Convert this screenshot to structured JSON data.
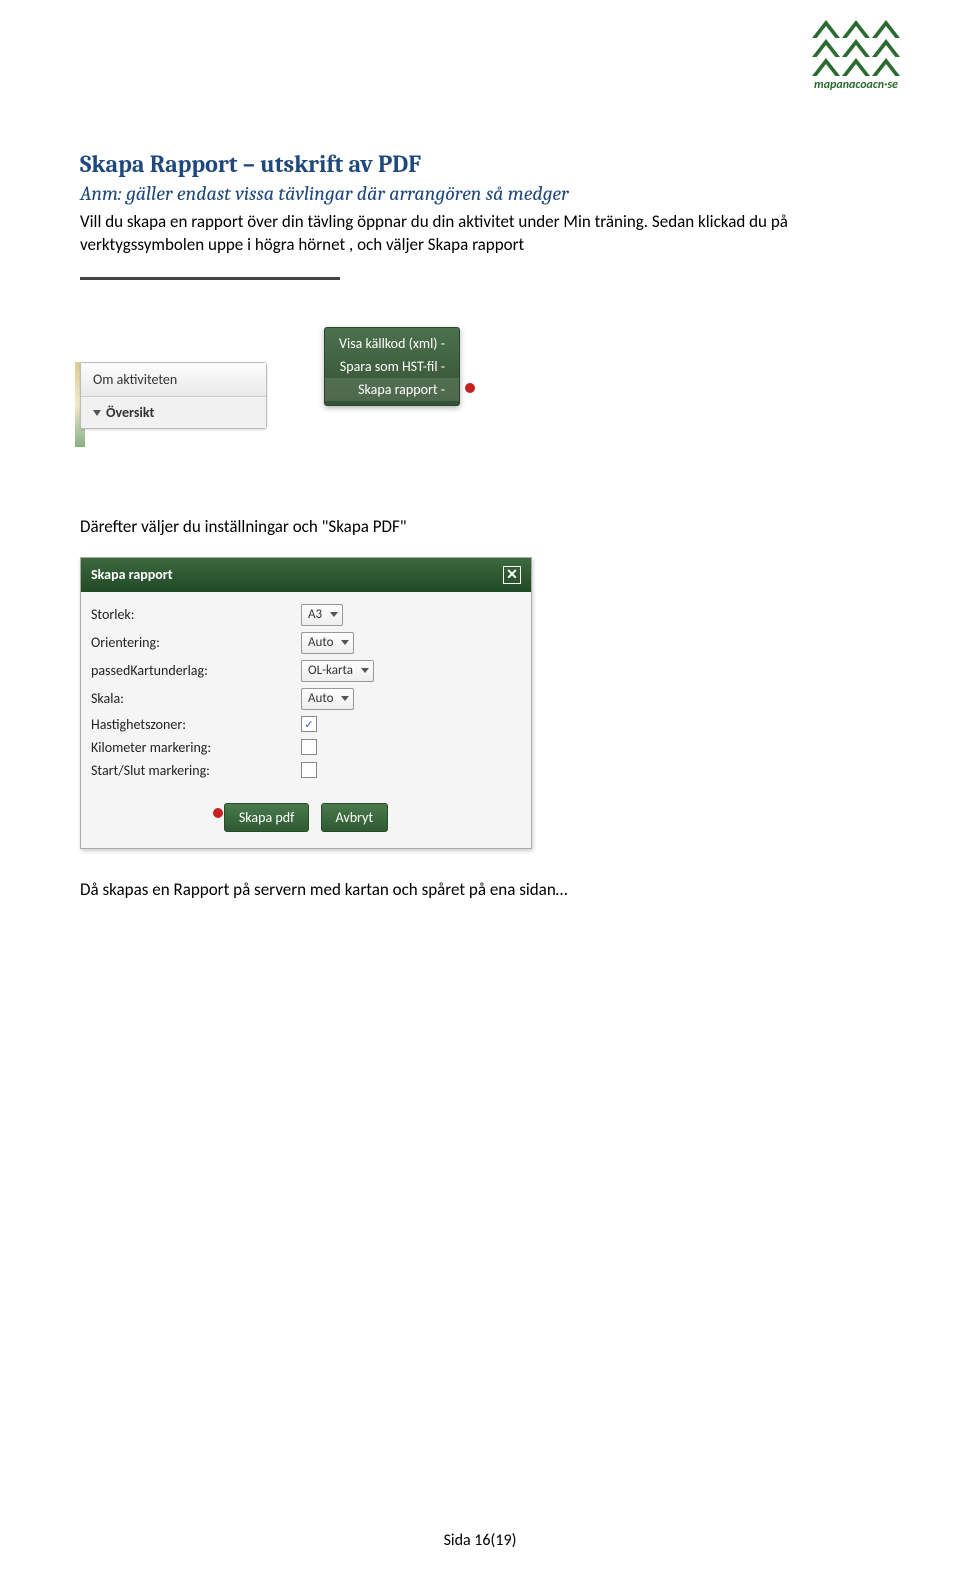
{
  "logo": {
    "text": "mapandcoach·se"
  },
  "heading": "Skapa Rapport – utskrift av PDF",
  "note": {
    "prefix": "Anm:",
    "text": " gäller endast vissa tävlingar där arrangören så medger"
  },
  "intro": "Vill du skapa en rapport över din tävling öppnar du din aktivitet under Min träning. Sedan klickad du på verktygssymbolen uppe i högra hörnet , och väljer Skapa rapport",
  "shot1": {
    "menu": {
      "item1": "Visa källkod (xml) -",
      "item2": "Spara som HST-fil -",
      "item3": "Skapa rapport -"
    },
    "tab": "Om aktiviteten",
    "subtab": "Översikt"
  },
  "mid_text": "Därefter väljer du inställningar och \"Skapa PDF\"",
  "shot2": {
    "title": "Skapa rapport",
    "rows": {
      "size": {
        "label": "Storlek:",
        "value": "A3"
      },
      "orient": {
        "label": "Orientering:",
        "value": "Auto"
      },
      "mapbg": {
        "label": "passedKartunderlag:",
        "value": "OL-karta"
      },
      "scale": {
        "label": "Skala:",
        "value": "Auto"
      },
      "speed": {
        "label": "Hastighetszoner:",
        "checked": "✓"
      },
      "km": {
        "label": "Kilometer markering:",
        "checked": ""
      },
      "startend": {
        "label": "Start/Slut markering:",
        "checked": ""
      }
    },
    "buttons": {
      "create": "Skapa pdf",
      "cancel": "Avbryt"
    }
  },
  "final_text": "Då skapas en Rapport på servern med kartan och spåret på ena sidan…",
  "page_number": "Sida 16(19)"
}
